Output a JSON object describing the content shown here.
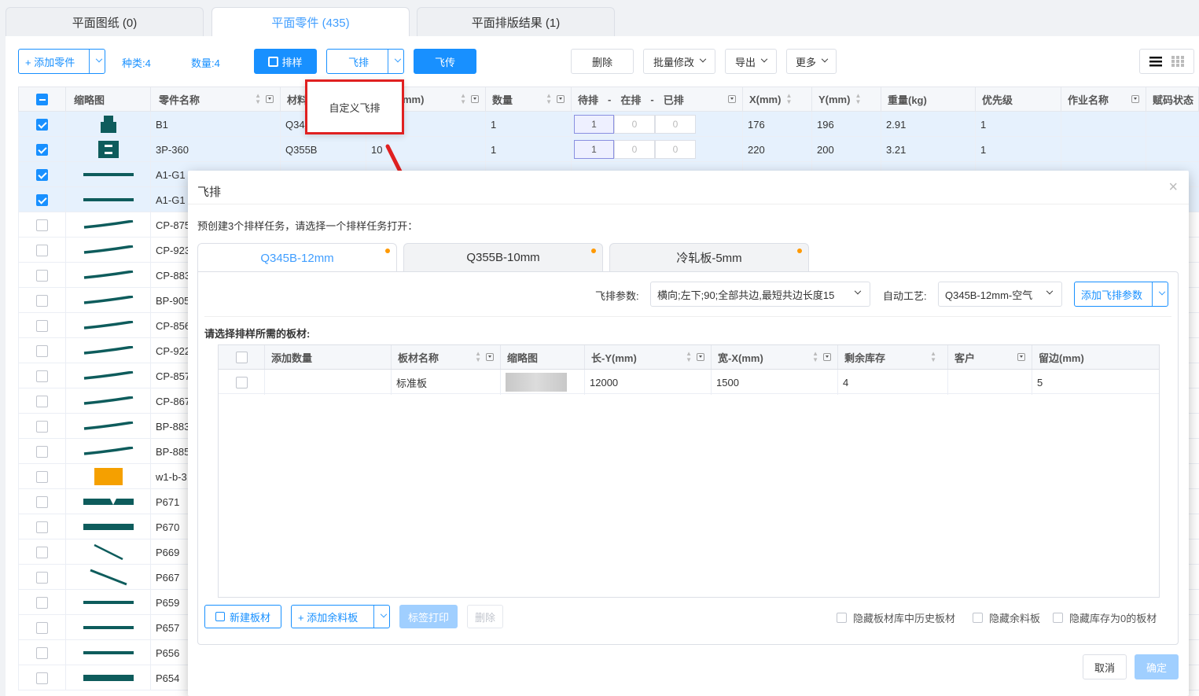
{
  "tabs": [
    {
      "label": "平面图纸 (0)"
    },
    {
      "label": "平面零件 (435)"
    },
    {
      "label": "平面排版结果 (1)"
    }
  ],
  "toolbar": {
    "add_part": "+ 添加零件",
    "kinds": "种类:4",
    "count": "数量:4",
    "nest": "排样",
    "fly_nest": "飞排",
    "fly_upload": "飞传",
    "delete": "删除",
    "batch_edit": "批量修改",
    "export": "导出",
    "more": "更多"
  },
  "dropdown": {
    "custom_fly_nest": "自定义飞排"
  },
  "table": {
    "headers": [
      "缩略图",
      "零件名称",
      "材料",
      "mm)",
      "数量",
      "待排",
      "-",
      "在排",
      "-",
      "已排",
      "X(mm)",
      "Y(mm)",
      "重量(kg)",
      "优先级",
      "作业名称",
      "赋码状态"
    ],
    "rows": [
      {
        "name": "B1",
        "material": "Q34",
        "thick": "",
        "qty": "1",
        "wait": "1",
        "on": "0",
        "done": "0",
        "x": "176",
        "y": "196",
        "w": "2.91",
        "pri": "1",
        "sel": true
      },
      {
        "name": "3P-360",
        "material": "Q355B",
        "thick": "10",
        "qty": "1",
        "wait": "1",
        "on": "0",
        "done": "0",
        "x": "220",
        "y": "200",
        "w": "3.21",
        "pri": "1",
        "sel": true
      },
      {
        "name": "A1-G1",
        "sel": true
      },
      {
        "name": "A1-G1",
        "sel": true
      },
      {
        "name": "CP-875"
      },
      {
        "name": "CP-923"
      },
      {
        "name": "CP-883"
      },
      {
        "name": "BP-905"
      },
      {
        "name": "CP-856"
      },
      {
        "name": "CP-922"
      },
      {
        "name": "CP-857"
      },
      {
        "name": "CP-867"
      },
      {
        "name": "BP-883"
      },
      {
        "name": "BP-885"
      },
      {
        "name": "w1-b-3"
      },
      {
        "name": "P671"
      },
      {
        "name": "P670"
      },
      {
        "name": "P669"
      },
      {
        "name": "P667"
      },
      {
        "name": "P659"
      },
      {
        "name": "P657"
      },
      {
        "name": "P656"
      },
      {
        "name": "P654"
      }
    ]
  },
  "modal": {
    "title": "飞排",
    "hint": "预创建3个排样任务，请选择一个排样任务打开：",
    "tabs": [
      {
        "label": "Q345B-12mm"
      },
      {
        "label": "Q355B-10mm"
      },
      {
        "label": "冷轧板-5mm"
      }
    ],
    "param_label": "飞排参数:",
    "param_value": "横向;左下;90;全部共边,最短共边长度15",
    "process_label": "自动工艺:",
    "process_value": "Q345B-12mm-空气",
    "add_param": "添加飞排参数",
    "select_sheet": "请选择排样所需的板材:",
    "sheet_headers": [
      "添加数量",
      "板材名称",
      "缩略图",
      "长-Y(mm)",
      "宽-X(mm)",
      "剩余库存",
      "客户",
      "留边(mm)"
    ],
    "sheet_row": {
      "name": "标准板",
      "len": "12000",
      "wid": "1500",
      "stock": "4",
      "margin": "5"
    },
    "new_sheet": "新建板材",
    "add_remnant": "+ 添加余料板",
    "label_print": "标签打印",
    "delete": "删除",
    "hide_history": "隐藏板材库中历史板材",
    "hide_remnant": "隐藏余料板",
    "hide_zero": "隐藏库存为0的板材",
    "cancel": "取消",
    "ok": "确定"
  },
  "colors": {
    "accent": "#1890ff",
    "highlight": "#e02020",
    "part": "#0e5c5c",
    "orange": "#f5a000"
  }
}
